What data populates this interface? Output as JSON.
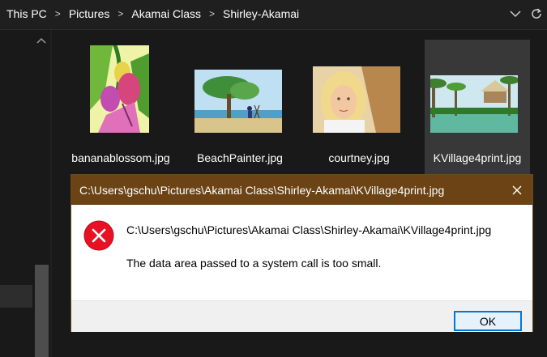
{
  "breadcrumb": {
    "items": [
      "This PC",
      "Pictures",
      "Akamai Class",
      "Shirley-Akamai"
    ],
    "separator": ">"
  },
  "files": [
    {
      "name": "bananablossom.jpg",
      "selected": false
    },
    {
      "name": "BeachPainter.jpg",
      "selected": false
    },
    {
      "name": "courtney.jpg",
      "selected": false
    },
    {
      "name": "KVillage4print.jpg",
      "selected": true
    }
  ],
  "dialog": {
    "title": "C:\\Users\\gschu\\Pictures\\Akamai Class\\Shirley-Akamai\\KVillage4print.jpg",
    "path": "C:\\Users\\gschu\\Pictures\\Akamai Class\\Shirley-Akamai\\KVillage4print.jpg",
    "message": "The data area passed to a system call is too small.",
    "ok_label": "OK",
    "icon": "error-icon",
    "titlebar_color": "#6b4315"
  },
  "icons": {
    "address_dropdown": "chevron-down-icon",
    "address_refresh": "refresh-icon",
    "nav_scroll_up": "chevron-up-icon",
    "dialog_close": "close-icon"
  }
}
